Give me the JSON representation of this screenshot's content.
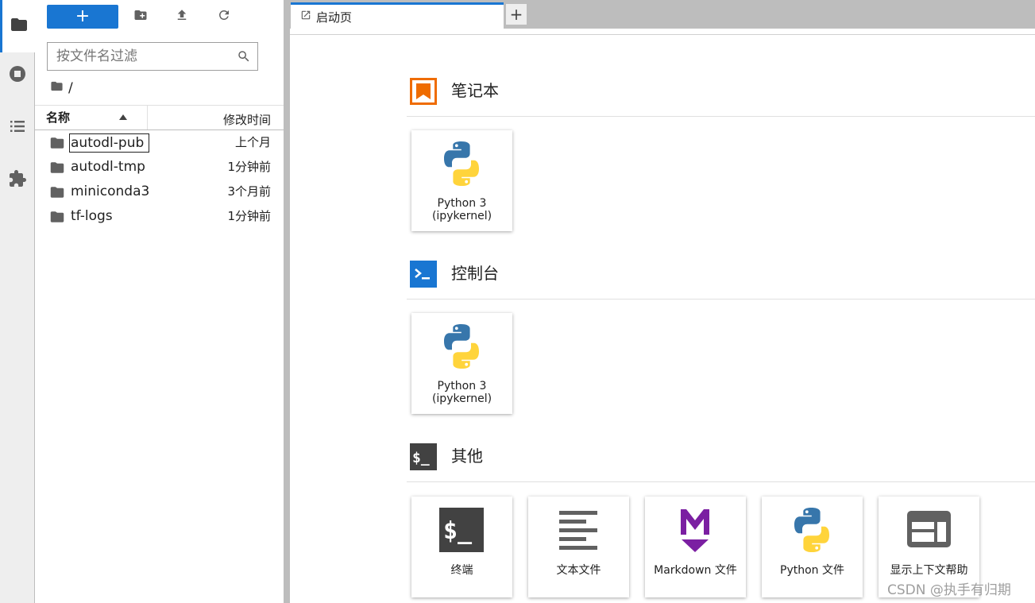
{
  "activity_bar": {
    "items": [
      {
        "name": "file-browser",
        "icon": "folder-icon"
      },
      {
        "name": "running-sessions",
        "icon": "stop-circle-icon"
      },
      {
        "name": "table-of-contents",
        "icon": "list-icon"
      },
      {
        "name": "extension-manager",
        "icon": "puzzle-icon"
      }
    ]
  },
  "file_browser": {
    "new_launcher_label": "+",
    "filter_placeholder": "按文件名过滤",
    "filter_value": "",
    "breadcrumb_path": "/",
    "columns": {
      "name": "名称",
      "modified": "修改时间"
    },
    "rows": [
      {
        "name": "autodl-pub",
        "modified": "上个月"
      },
      {
        "name": "autodl-tmp",
        "modified": "1分钟前"
      },
      {
        "name": "miniconda3",
        "modified": "3个月前"
      },
      {
        "name": "tf-logs",
        "modified": "1分钟前"
      }
    ]
  },
  "tabs": {
    "launcher_tab_label": "启动页",
    "add_tab_label": "+"
  },
  "launcher": {
    "sections": [
      {
        "title": "笔记本",
        "cards": [
          {
            "line1": "Python 3",
            "line2": "(ipykernel)"
          }
        ]
      },
      {
        "title": "控制台",
        "cards": [
          {
            "line1": "Python 3",
            "line2": "(ipykernel)"
          }
        ]
      },
      {
        "title": "其他",
        "cards": [
          {
            "label": "终端"
          },
          {
            "label": "文本文件"
          },
          {
            "label": "Markdown 文件"
          },
          {
            "label": "Python 文件"
          },
          {
            "label": "显示上下文帮助"
          }
        ]
      }
    ]
  },
  "watermark": "CSDN @执手有归期",
  "colors": {
    "accent": "#1976d2",
    "notebook_icon": "#ef6c00",
    "console_icon": "#1976d2",
    "markdown_icon": "#7b1fa2"
  }
}
